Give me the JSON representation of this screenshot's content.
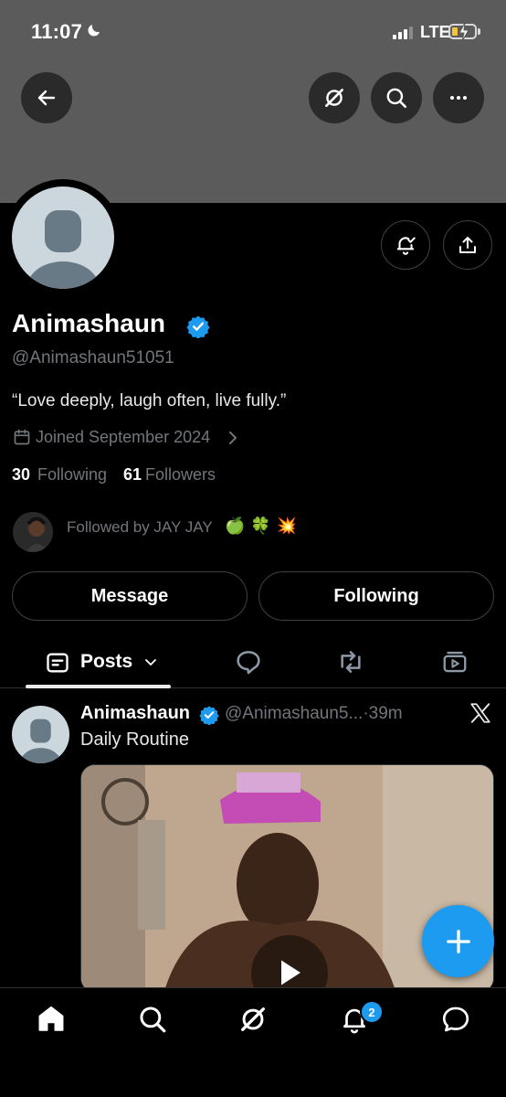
{
  "status_bar": {
    "time": "11:07",
    "network": "LTE",
    "battery_level": 0.25
  },
  "header": {
    "icons": [
      "back-arrow-icon",
      "grok-icon",
      "search-icon",
      "more-icon"
    ]
  },
  "profile": {
    "display_name": "Animashaun",
    "verified": true,
    "handle": "@Animashaun51051",
    "bio": "“Love deeply, laugh often, live fully.”",
    "joined": "Joined September 2024",
    "following_count": "30",
    "following_label": "Following",
    "followers_count": "61",
    "followers_label": "Followers",
    "followed_by": "Followed by JAY JAY",
    "followed_by_emoji": [
      "🍏",
      "🍀",
      "💥"
    ],
    "message_label": "Message",
    "following_button_label": "Following"
  },
  "tabs": {
    "active_label": "Posts",
    "icons": [
      "posts-icon",
      "replies-icon",
      "reposts-icon",
      "media-icon"
    ]
  },
  "post": {
    "author": "Animashaun",
    "handle": "@Animashaun5...",
    "time": "·39m",
    "text": "Daily Routine",
    "source_icon": "x-logo-icon"
  },
  "bottom_nav": {
    "items": [
      "home-icon",
      "search-icon",
      "grok-icon",
      "notifications-icon",
      "messages-icon"
    ],
    "notifications_badge": "2"
  },
  "colors": {
    "accent": "#1d9bf0",
    "banner": "#5b5b5b",
    "muted_text": "#71767b",
    "background": "#000000"
  }
}
